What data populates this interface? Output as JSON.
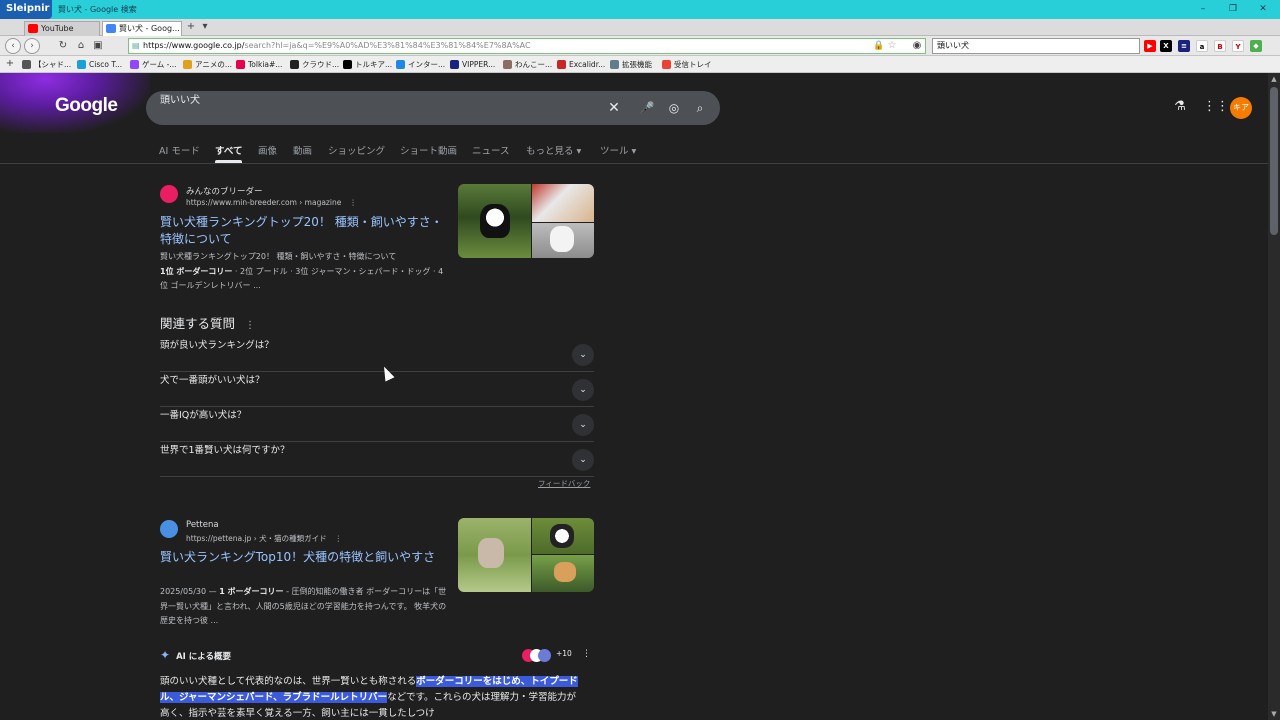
{
  "window": {
    "app_name": "Sleipnir",
    "title": "賢い犬 - Google 検索",
    "controls": [
      "–",
      "❐",
      "✕"
    ]
  },
  "tabs": [
    {
      "label": "YouTube",
      "color": "#ff0000"
    },
    {
      "label": "賢い犬 - Goog...",
      "color": "#4285f4"
    }
  ],
  "tab_add": "+",
  "tab_menu": "▾",
  "nav": {
    "url_host": "https://www.google.co.jp/",
    "url_rest": "search?hl=ja&q=%E9%A0%AD%E3%81%84%E3%81%84%E7%8A%AC",
    "search_value": "頭いい犬"
  },
  "bookmarks": [
    {
      "label": "【シャド...",
      "color": "#555555"
    },
    {
      "label": "Cisco T...",
      "color": "#1ba0d7"
    },
    {
      "label": "ゲーム -...",
      "color": "#9146ff"
    },
    {
      "label": "アニメの...",
      "color": "#e0a020"
    },
    {
      "label": "Tolkia#...",
      "color": "#e6004c"
    },
    {
      "label": "クラウド...",
      "color": "#222222"
    },
    {
      "label": "トルキア...",
      "color": "#000000"
    },
    {
      "label": "インター...",
      "color": "#1e88e5"
    },
    {
      "label": "VIPPER...",
      "color": "#1a237e"
    },
    {
      "label": "わんこー...",
      "color": "#8d6e63"
    },
    {
      "label": "Excalidr...",
      "color": "#c62828"
    },
    {
      "label": "拡張機能",
      "color": "#607d8b"
    },
    {
      "label": "受信トレイ",
      "color": "#ea4335"
    }
  ],
  "google": {
    "logo": "Google",
    "query": "頭いい犬",
    "avatar": "キア",
    "tabs": [
      "AI モード",
      "すべて",
      "画像",
      "動画",
      "ショッピング",
      "ショート動画",
      "ニュース",
      "もっと見る ▾",
      "ツール ▾"
    ]
  },
  "results": [
    {
      "site": "みんなのブリーダー",
      "url": "https://www.min-breeder.com › magazine",
      "title": "賢い犬種ランキングトップ20！ 種類・飼いやすさ・特徴について",
      "snippet_pre": "賢い犬種ランキングトップ20！ 種類・飼いやすさ・特徴について",
      "snippet_bold": "1位 ボーダーコリー",
      "snippet_post": " · 2位 プードル · 3位 ジャーマン・シェパード・ドッグ · 4位 ゴールデンレトリバー ...",
      "icon_color": "#e91e63"
    },
    {
      "site": "Pettena",
      "url": "https://pettena.jp › 犬・猫の種類ガイド",
      "title": "賢い犬ランキングTop10！犬種の特徴と飼いやすさ",
      "snippet_pre": "2025/05/30 — ",
      "snippet_bold": "1 ボーダーコリー",
      "snippet_post": " - 圧倒的知能の働き者 ボーダーコリーは「世界一賢い犬種」と言われ、人間の5歳児ほどの学習能力を持つんです。 牧羊犬の歴史を持つ彼 ...",
      "icon_color": "#4a90e2"
    }
  ],
  "paa": {
    "title": "関連する質問",
    "questions": [
      "頭が良い犬ランキングは？",
      "犬で一番頭がいい犬は？",
      "一番IQが高い犬は？",
      "世界で1番賢い犬は何ですか？"
    ],
    "feedback": "フィードバック"
  },
  "ai_overview": {
    "heading": "AI による概要",
    "source_count": "+10",
    "text_pre": "頭のいい犬種として代表的なのは、世界一賢いとも称される",
    "text_highlight": "ボーダーコリーをはじめ、トイプードル、ジャーマンシェパード、ラブラドールレトリバー",
    "text_post": "などです。これらの犬は理解力・学習能力が高く、指示や芸を素早く覚える一方、飼い主には一貫したしつけ"
  }
}
